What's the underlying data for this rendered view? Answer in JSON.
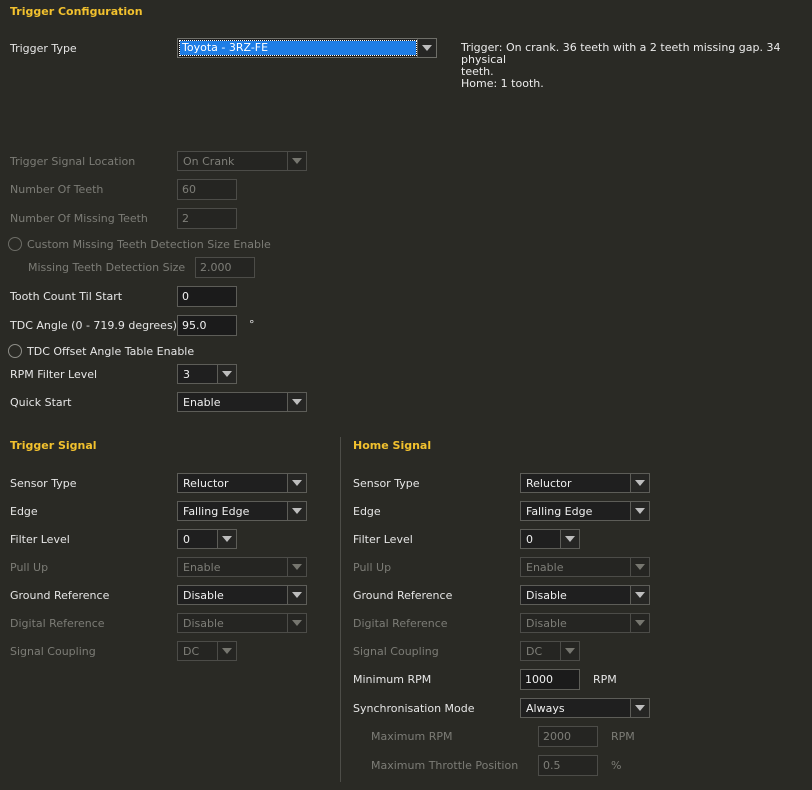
{
  "config": {
    "title": "Trigger Configuration",
    "trigger_type": {
      "label": "Trigger Type",
      "value": "Toyota - 3RZ-FE"
    },
    "description": [
      "Trigger: On crank. 36 teeth with a 2 teeth missing gap. 34 physical",
      "teeth.",
      "Home: 1 tooth."
    ],
    "signal_location": {
      "label": "Trigger Signal Location",
      "value": "On Crank"
    },
    "num_teeth": {
      "label": "Number Of Teeth",
      "value": "60"
    },
    "num_missing": {
      "label": "Number Of Missing Teeth",
      "value": "2"
    },
    "custom_missing": {
      "label": "Custom Missing Teeth Detection Size Enable"
    },
    "missing_size": {
      "label": "Missing Teeth Detection Size",
      "value": "2.000"
    },
    "tooth_count": {
      "label": "Tooth Count Til Start",
      "value": "0"
    },
    "tdc_angle": {
      "label": "TDC Angle (0 - 719.9 degrees)",
      "value": "95.0",
      "unit": "°"
    },
    "tdc_offset": {
      "label": "TDC Offset Angle Table Enable"
    },
    "rpm_filter": {
      "label": "RPM Filter Level",
      "value": "3"
    },
    "quick_start": {
      "label": "Quick Start",
      "value": "Enable"
    }
  },
  "trigger_signal": {
    "title": "Trigger Signal",
    "sensor_type": {
      "label": "Sensor Type",
      "value": "Reluctor"
    },
    "edge": {
      "label": "Edge",
      "value": "Falling Edge"
    },
    "filter_level": {
      "label": "Filter Level",
      "value": "0"
    },
    "pull_up": {
      "label": "Pull Up",
      "value": "Enable"
    },
    "ground_ref": {
      "label": "Ground Reference",
      "value": "Disable"
    },
    "digital_ref": {
      "label": "Digital Reference",
      "value": "Disable"
    },
    "coupling": {
      "label": "Signal Coupling",
      "value": "DC"
    }
  },
  "home_signal": {
    "title": "Home Signal",
    "sensor_type": {
      "label": "Sensor Type",
      "value": "Reluctor"
    },
    "edge": {
      "label": "Edge",
      "value": "Falling Edge"
    },
    "filter_level": {
      "label": "Filter Level",
      "value": "0"
    },
    "pull_up": {
      "label": "Pull Up",
      "value": "Enable"
    },
    "ground_ref": {
      "label": "Ground Reference",
      "value": "Disable"
    },
    "digital_ref": {
      "label": "Digital Reference",
      "value": "Disable"
    },
    "coupling": {
      "label": "Signal Coupling",
      "value": "DC"
    },
    "min_rpm": {
      "label": "Minimum RPM",
      "value": "1000",
      "unit": "RPM"
    },
    "sync_mode": {
      "label": "Synchronisation Mode",
      "value": "Always"
    },
    "max_rpm": {
      "label": "Maximum RPM",
      "value": "2000",
      "unit": "RPM"
    },
    "max_tp": {
      "label": "Maximum Throttle Position",
      "value": "0.5",
      "unit": "%"
    }
  },
  "colors": {
    "background": "#2a2a25",
    "section_title": "#f2c12e",
    "selection": "#1e7de6",
    "disabled_text": "#7c7c76"
  },
  "icons": {
    "dropdown": "chevron-down-icon",
    "checkbox": "radio-circle-icon"
  }
}
